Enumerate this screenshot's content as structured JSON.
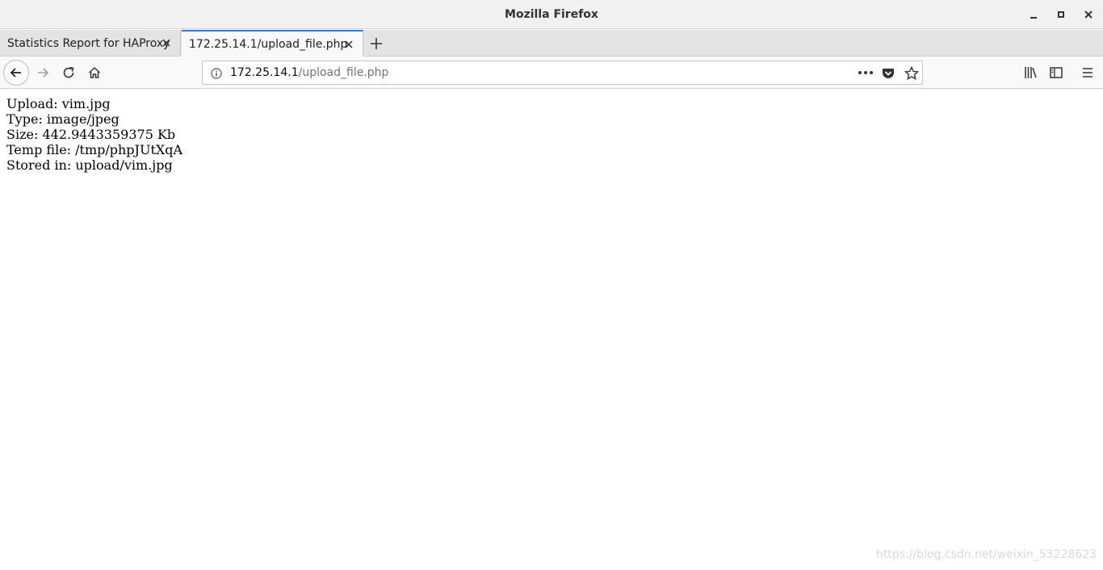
{
  "window": {
    "title": "Mozilla Firefox"
  },
  "tabs": [
    {
      "label": "Statistics Report for HAProxy",
      "active": false
    },
    {
      "label": "172.25.14.1/upload_file.php",
      "active": true
    }
  ],
  "navbar": {
    "url_host": "172.25.14.1",
    "url_path": "/upload_file.php"
  },
  "page": {
    "lines": [
      "Upload: vim.jpg",
      "Type: image/jpeg",
      "Size: 442.9443359375 Kb",
      "Temp file: /tmp/phpJUtXqA",
      "Stored in: upload/vim.jpg"
    ]
  },
  "watermark": "https://blog.csdn.net/weixin_53228623",
  "colors": {
    "tab_accent": "#0a84ff",
    "chrome_bg": "#f1f1f1"
  },
  "icons": [
    "minimize-icon",
    "maximize-icon",
    "close-icon",
    "tab-close-icon",
    "new-tab-icon",
    "back-arrow-icon",
    "forward-arrow-icon",
    "reload-icon",
    "home-icon",
    "info-icon",
    "more-dots-icon",
    "pocket-icon",
    "bookmark-star-icon",
    "library-icon",
    "sidebar-icon",
    "hamburger-menu-icon"
  ]
}
